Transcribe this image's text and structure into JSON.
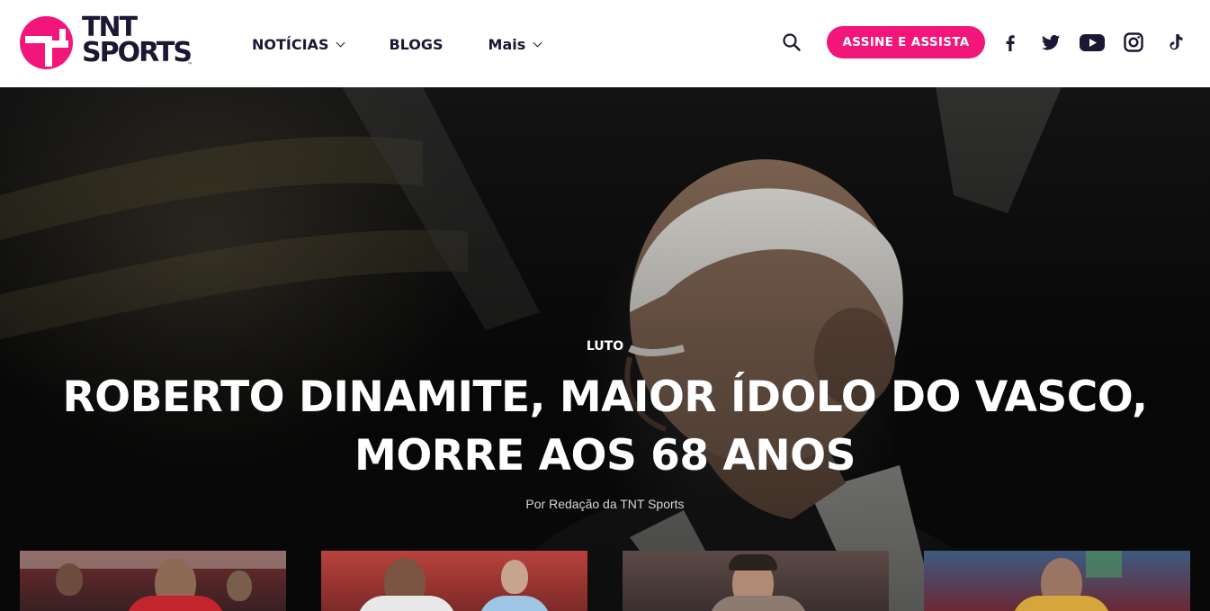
{
  "brand": {
    "name": "TNT SPORTS",
    "line1": "TNT",
    "line2": "SPORTS",
    "tm": "™",
    "accent_color": "#f2157a",
    "text_color": "#1a1833"
  },
  "nav": {
    "items": [
      {
        "label": "NOTÍCIAS",
        "has_dropdown": true
      },
      {
        "label": "BLOGS",
        "has_dropdown": false
      },
      {
        "label": "Mais",
        "has_dropdown": true
      }
    ]
  },
  "header": {
    "search_icon": "search-icon",
    "subscribe_label": "ASSINE E ASSISTA",
    "social": [
      "facebook-icon",
      "twitter-icon",
      "youtube-icon",
      "instagram-icon",
      "tiktok-icon"
    ]
  },
  "hero": {
    "category": "LUTO",
    "title": "ROBERTO DINAMITE, MAIOR ÍDOLO DO VASCO, MORRE AOS 68 ANOS",
    "byline": "Por Redação da TNT Sports"
  },
  "cards": [
    {
      "name": "news-card-1"
    },
    {
      "name": "news-card-2"
    },
    {
      "name": "news-card-3"
    },
    {
      "name": "news-card-4"
    }
  ]
}
